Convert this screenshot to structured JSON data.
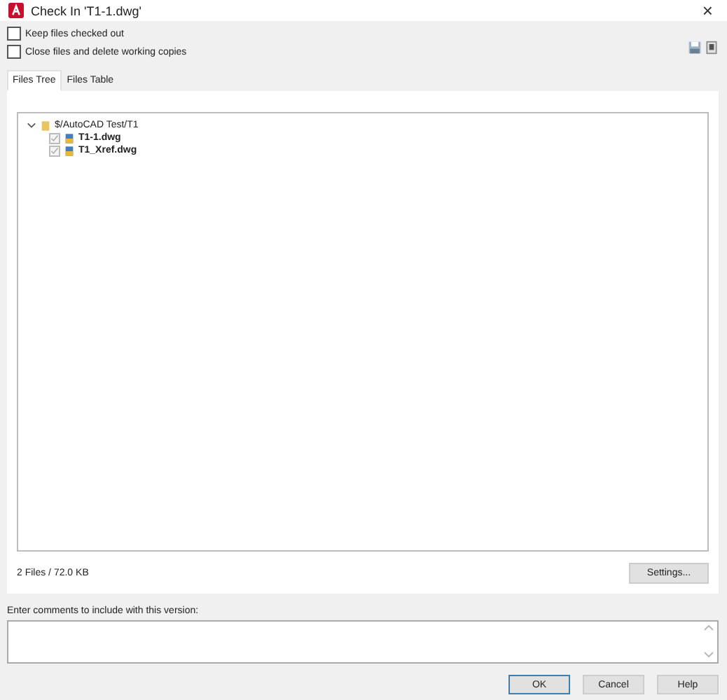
{
  "window": {
    "title": "Check In 'T1-1.dwg'",
    "close": "×"
  },
  "options": [
    {
      "label": "Keep files checked out",
      "checked": false
    },
    {
      "label": "Close files and delete working copies",
      "checked": false
    }
  ],
  "tabs": [
    {
      "label": "Files Tree",
      "selected": true
    },
    {
      "label": "Files Table",
      "selected": false
    }
  ],
  "tree": [
    {
      "label": "$/AutoCAD Test/T1",
      "expanded": true,
      "children": [
        {
          "label": "T1-1.dwg",
          "checked": true,
          "disabled": true
        },
        {
          "label": "T1_Xref.dwg",
          "checked": true,
          "disabled": true
        }
      ]
    }
  ],
  "status": "2 Files / 72.0 KB",
  "settings_button": "Settings...",
  "comments": {
    "label": "Enter comments to include with this version:"
  },
  "buttons": [
    {
      "label": "OK",
      "default": true
    },
    {
      "label": "Cancel",
      "default": false
    },
    {
      "label": "Help",
      "default": false
    }
  ]
}
